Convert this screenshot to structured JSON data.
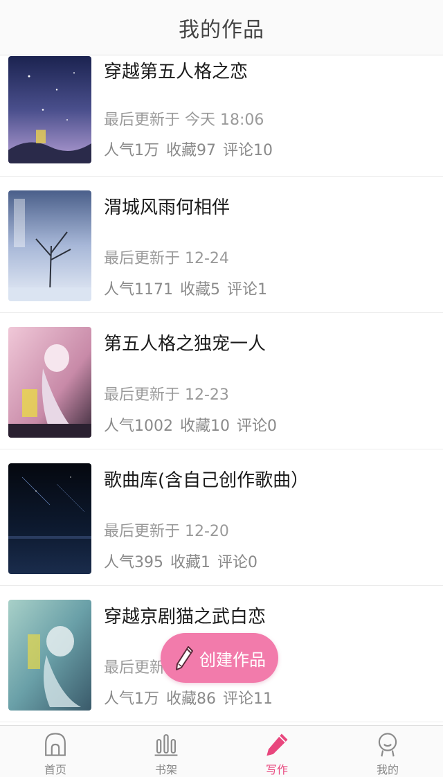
{
  "header": {
    "title": "我的作品"
  },
  "works": [
    {
      "title": "穿越第五人格之恋",
      "updated": "最后更新于 今天 18:06",
      "popularity": "人气1万",
      "favorites": "收藏97",
      "comments": "评论10"
    },
    {
      "title": "渭城风雨何相伴",
      "updated": "最后更新于 12-24",
      "popularity": "人气1171",
      "favorites": "收藏5",
      "comments": "评论1"
    },
    {
      "title": "第五人格之独宠一人",
      "updated": "最后更新于 12-23",
      "popularity": "人气1002",
      "favorites": "收藏10",
      "comments": "评论0"
    },
    {
      "title": "歌曲库(含自己创作歌曲）",
      "updated": "最后更新于 12-20",
      "popularity": "人气395",
      "favorites": "收藏1",
      "comments": "评论0"
    },
    {
      "title": "穿越京剧猫之武白恋",
      "updated": "最后更新于",
      "popularity": "人气1万",
      "favorites": "收藏86",
      "comments": "评论11"
    }
  ],
  "fab": {
    "label": "创建作品",
    "icon": "pencil-icon",
    "color": "#f27bab"
  },
  "tabbar": {
    "active_color": "#e8467d",
    "tabs": [
      {
        "label": "首页",
        "icon": "home-icon"
      },
      {
        "label": "书架",
        "icon": "bookshelf-icon"
      },
      {
        "label": "写作",
        "icon": "pencil-icon"
      },
      {
        "label": "我的",
        "icon": "profile-icon"
      }
    ]
  }
}
